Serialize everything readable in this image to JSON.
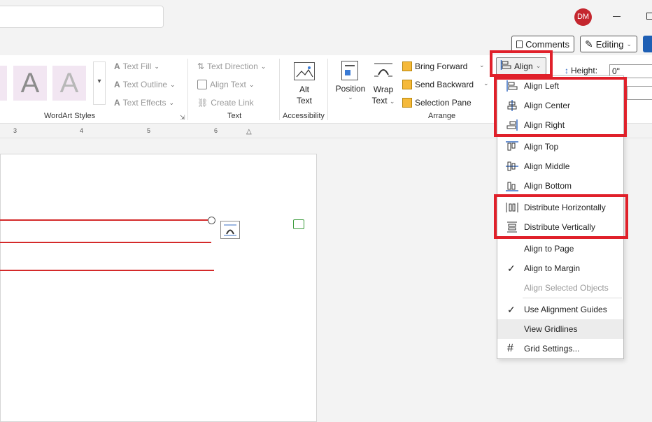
{
  "titlebar": {
    "avatar_initials": "DM"
  },
  "top_actions": {
    "comments": "Comments",
    "editing": "Editing"
  },
  "wordart": {
    "group_label": "WordArt Styles",
    "text_fill": "Text Fill",
    "text_outline": "Text Outline",
    "text_effects": "Text Effects",
    "style_glyph": "A"
  },
  "text_group": {
    "group_label": "Text",
    "text_direction": "Text Direction",
    "align_text": "Align Text",
    "create_link": "Create Link"
  },
  "accessibility": {
    "group_label": "Accessibility",
    "alt_text_line1": "Alt",
    "alt_text_line2": "Text"
  },
  "arrange": {
    "group_label": "Arrange",
    "position": "Position",
    "wrap_line1": "Wrap",
    "wrap_line2": "Text",
    "bring_forward": "Bring Forward",
    "send_backward": "Send Backward",
    "selection_pane": "Selection Pane",
    "align": "Align"
  },
  "size": {
    "height_label": "Height:",
    "height_value": "0\""
  },
  "ruler": {
    "marks": [
      "3",
      "4",
      "5",
      "6"
    ]
  },
  "align_menu": {
    "items": [
      {
        "label": "Align Left",
        "icon": "align-left-icon"
      },
      {
        "label": "Align Center",
        "icon": "align-center-icon"
      },
      {
        "label": "Align Right",
        "icon": "align-right-icon"
      },
      {
        "label": "Align Top",
        "icon": "align-top-icon"
      },
      {
        "label": "Align Middle",
        "icon": "align-middle-icon"
      },
      {
        "label": "Align Bottom",
        "icon": "align-bottom-icon"
      },
      {
        "label": "Distribute Horizontally",
        "icon": "distribute-horizontally-icon"
      },
      {
        "label": "Distribute Vertically",
        "icon": "distribute-vertically-icon"
      },
      {
        "label": "Align to Page",
        "icon": ""
      },
      {
        "label": "Align to Margin",
        "icon": "checkmark-icon"
      },
      {
        "label": "Align Selected Objects",
        "icon": "",
        "disabled": true
      },
      {
        "label": "Use Alignment Guides",
        "icon": "checkmark-icon"
      },
      {
        "label": "View Gridlines",
        "icon": ""
      },
      {
        "label": "Grid Settings...",
        "icon": "grid-icon"
      }
    ]
  },
  "colors": {
    "highlight": "#e0202a",
    "shape_line": "#d42a2a",
    "avatar": "#c4262e"
  }
}
